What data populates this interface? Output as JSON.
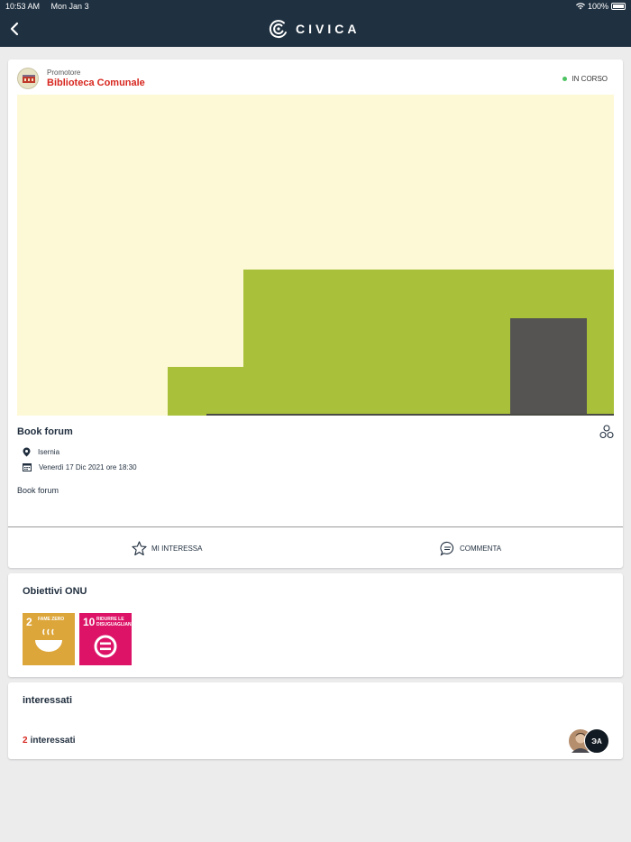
{
  "status_bar": {
    "time": "10:53 AM",
    "date": "Mon Jan 3",
    "battery": "100%"
  },
  "header": {
    "logo_text": "CIVICA"
  },
  "event": {
    "promoter_label": "Promotore",
    "promoter_name": "Biblioteca Comunale",
    "status": "IN CORSO",
    "title": "Book forum",
    "location": "Isernia",
    "datetime": "Venerdì 17 Dic 2021 ore 18:30",
    "description": "Book forum",
    "actions": {
      "like_label": "MI INTERESSA",
      "comment_label": "COMMENTA"
    }
  },
  "goals": {
    "title": "Obiettivi ONU",
    "items": [
      {
        "number": "2",
        "label": "FAME ZERO",
        "color": "#DDA63A"
      },
      {
        "number": "10",
        "label": "RIDURRE LE DISUGUAGLIANZE",
        "color": "#DD1367"
      }
    ]
  },
  "interested": {
    "title": "interessati",
    "count": "2",
    "count_label": "interessati",
    "avatar_initials": "ЭА"
  },
  "colors": {
    "header_bg": "#1F3040",
    "accent_red": "#D7261E",
    "status_green": "#4CC261",
    "hero_bg": "#FDF8D6",
    "hero_green": "#A9C13A",
    "hero_door": "#555452"
  }
}
